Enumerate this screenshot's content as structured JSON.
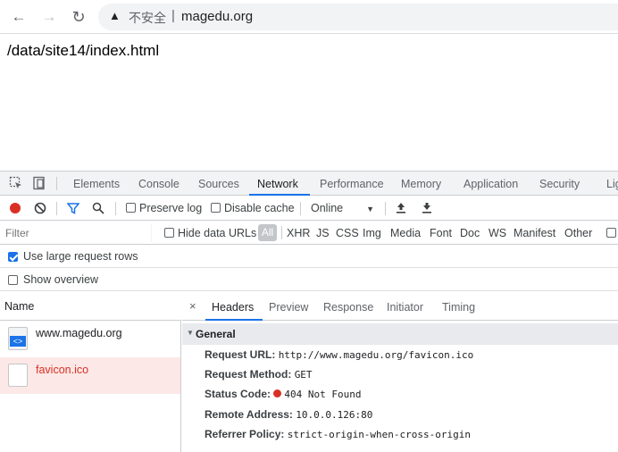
{
  "browser": {
    "insecure_label": "不安全",
    "separator": "|",
    "url": "magedu.org"
  },
  "page": {
    "body_text": "/data/site14/index.html"
  },
  "devtools": {
    "tabs": [
      "Elements",
      "Console",
      "Sources",
      "Network",
      "Performance",
      "Memory",
      "Application",
      "Security",
      "Lig"
    ],
    "active_tab": "Network",
    "toolbar": {
      "preserve_log": "Preserve log",
      "disable_cache": "Disable cache",
      "throttle": "Online",
      "throttle_arrow": "▼"
    },
    "filter": {
      "placeholder": "Filter",
      "hide_data_urls": "Hide data URLs",
      "types": [
        "All",
        "XHR",
        "JS",
        "CSS",
        "Img",
        "Media",
        "Font",
        "Doc",
        "WS",
        "Manifest",
        "Other"
      ]
    },
    "options": {
      "large_rows": "Use large request rows",
      "large_rows_checked": true,
      "show_overview": "Show overview",
      "show_overview_checked": false
    },
    "requests": {
      "header": "Name",
      "items": [
        {
          "name": "www.magedu.org",
          "icon": "html-document-icon",
          "error": false
        },
        {
          "name": "favicon.ico",
          "icon": "blank-file-icon",
          "error": true
        }
      ]
    },
    "detail": {
      "close": "×",
      "tabs": [
        "Headers",
        "Preview",
        "Response",
        "Initiator",
        "Timing"
      ],
      "active_tab": "Headers",
      "section": "General",
      "fields": [
        {
          "key": "Request URL:",
          "value": "http://www.magedu.org/favicon.ico"
        },
        {
          "key": "Request Method:",
          "value": "GET"
        },
        {
          "key": "Status Code:",
          "value": "404 Not Found"
        },
        {
          "key": "Remote Address:",
          "value": "10.0.0.126:80"
        },
        {
          "key": "Referrer Policy:",
          "value": "strict-origin-when-cross-origin"
        }
      ]
    }
  },
  "colors": {
    "accent": "#1a73e8",
    "error": "#d93025",
    "error_row_bg": "#fce8e6"
  }
}
